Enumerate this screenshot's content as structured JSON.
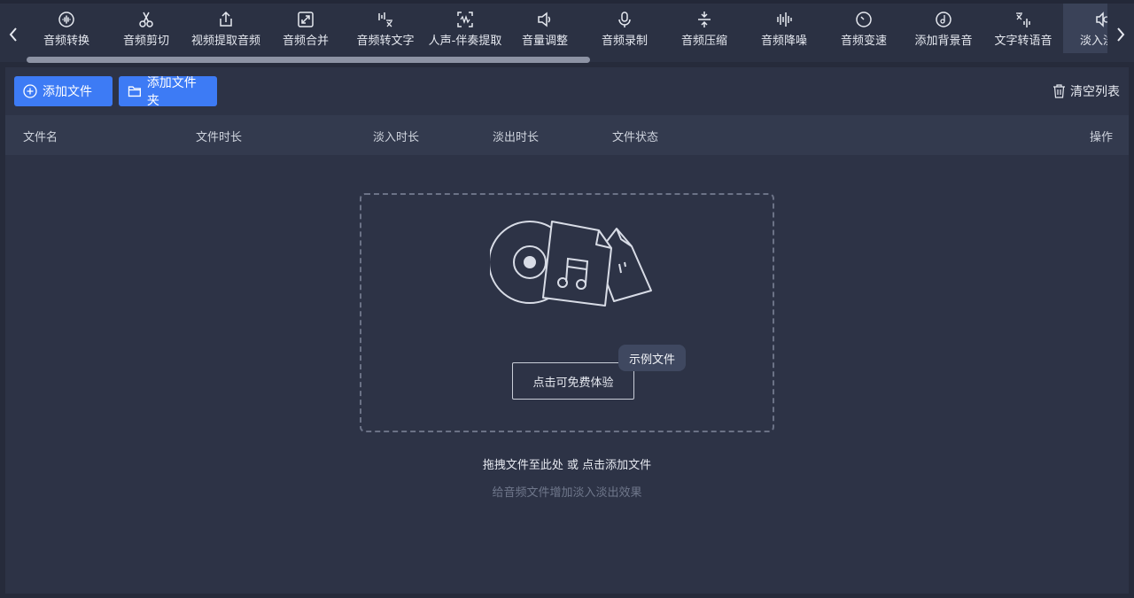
{
  "toolbar": {
    "tools": [
      {
        "label": "音频转换",
        "icon": "audio-convert-icon"
      },
      {
        "label": "音频剪切",
        "icon": "scissors-icon"
      },
      {
        "label": "视频提取音频",
        "icon": "upload-icon"
      },
      {
        "label": "音频合并",
        "icon": "merge-icon"
      },
      {
        "label": "音频转文字",
        "icon": "speech-to-text-icon"
      },
      {
        "label": "人声-伴奏提取",
        "icon": "voice-extract-icon"
      },
      {
        "label": "音量调整",
        "icon": "volume-icon"
      },
      {
        "label": "音频录制",
        "icon": "microphone-icon"
      },
      {
        "label": "音频压缩",
        "icon": "compress-icon"
      },
      {
        "label": "音频降噪",
        "icon": "noise-reduction-icon"
      },
      {
        "label": "音频变速",
        "icon": "speed-icon"
      },
      {
        "label": "添加背景音",
        "icon": "music-disc-icon"
      },
      {
        "label": "文字转语音",
        "icon": "text-to-speech-icon"
      },
      {
        "label": "淡入淡出",
        "icon": "fade-icon"
      }
    ],
    "active_index": 13
  },
  "actions": {
    "add_file": "添加文件",
    "add_folder": "添加文件夹",
    "clear_list": "清空列表"
  },
  "table": {
    "columns": {
      "name": "文件名",
      "duration": "文件时长",
      "fade_in": "淡入时长",
      "fade_out": "淡出时长",
      "status": "文件状态",
      "ops": "操作"
    }
  },
  "dropzone": {
    "try_button": "点击可免费体验",
    "sample_tag": "示例文件",
    "hint": "拖拽文件至此处 或 点击添加文件",
    "sub_hint": "给音频文件增加淡入淡出效果"
  },
  "colors": {
    "background": "#262b3b",
    "panel": "#2d3346",
    "accent": "#3d7bf5"
  }
}
